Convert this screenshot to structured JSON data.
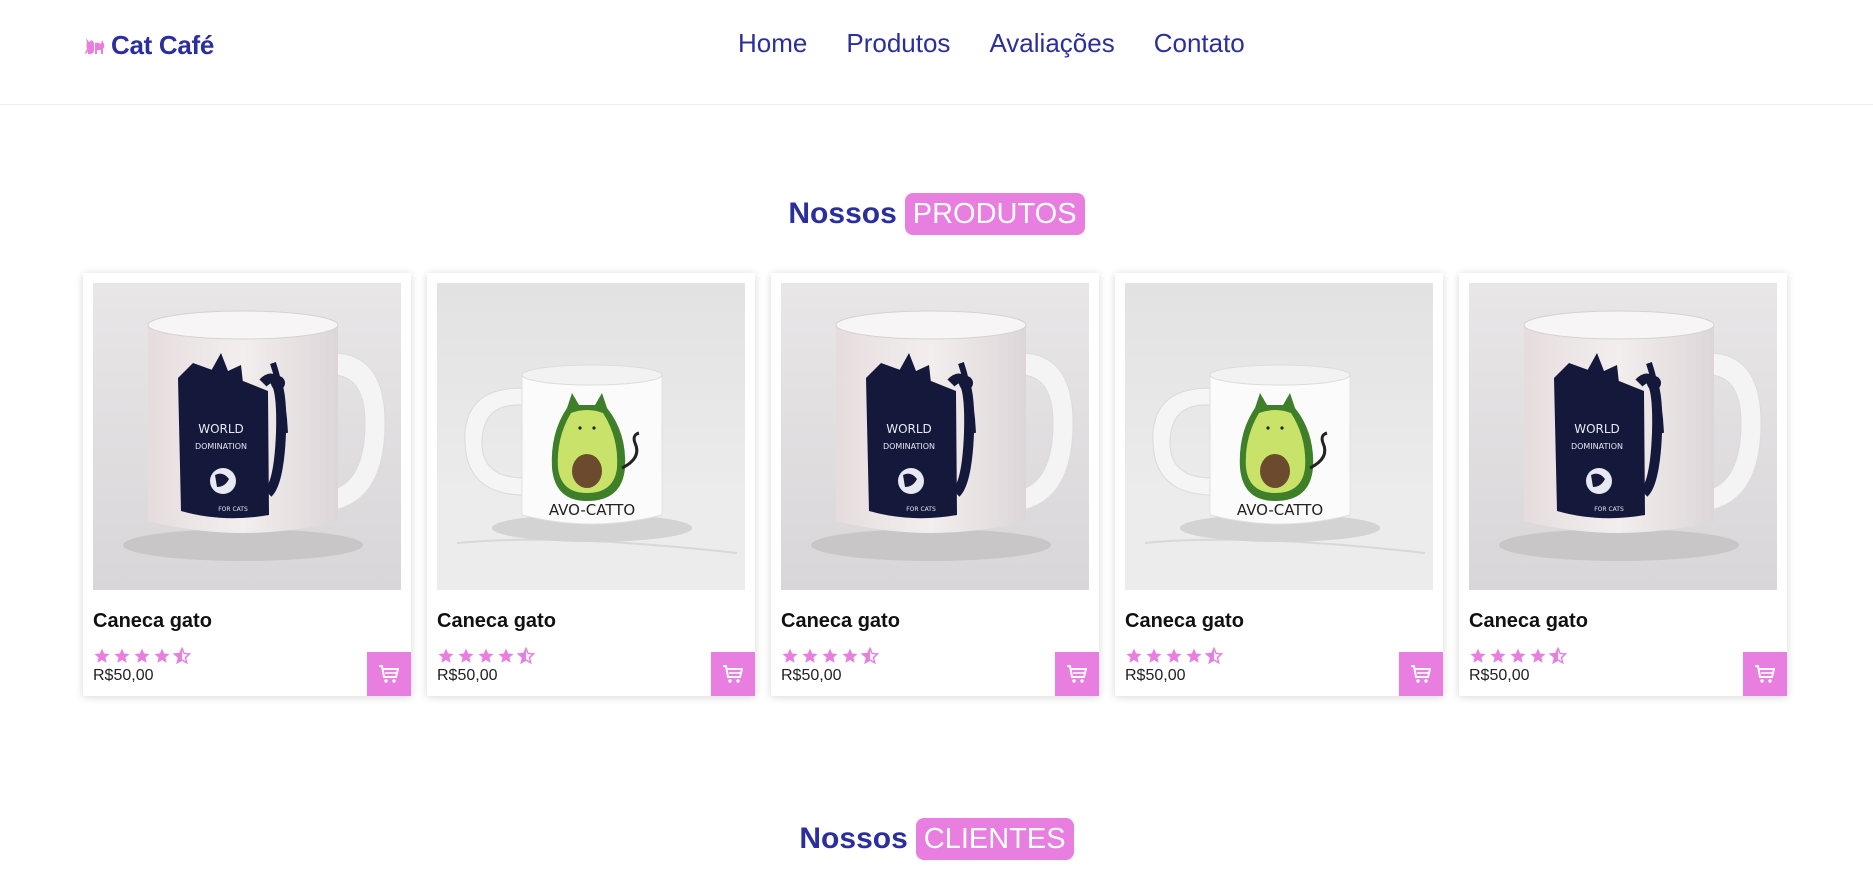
{
  "header": {
    "logo_text": "Cat Café",
    "logo_icon": "cat-icon",
    "nav": [
      "Home",
      "Produtos",
      "Avaliações",
      "Contato"
    ]
  },
  "products_section": {
    "title_word": "Nossos",
    "title_badge": "PRODUTOS"
  },
  "clients_section": {
    "title_word": "Nossos",
    "title_badge": "CLIENTES"
  },
  "products": [
    {
      "name": "Caneca gato",
      "price": "R$50,00",
      "rating": 4.5,
      "image": "world-domination-mug",
      "mug_text": [
        "WORLD",
        "DOMINATION",
        "FOR CATS"
      ]
    },
    {
      "name": "Caneca gato",
      "price": "R$50,00",
      "rating": 4.5,
      "image": "avo-catto-mug",
      "mug_text": [
        "AVO-CATTO"
      ]
    },
    {
      "name": "Caneca gato",
      "price": "R$50,00",
      "rating": 4.5,
      "image": "world-domination-mug",
      "mug_text": [
        "WORLD",
        "DOMINATION",
        "FOR CATS"
      ]
    },
    {
      "name": "Caneca gato",
      "price": "R$50,00",
      "rating": 4.5,
      "image": "avo-catto-mug",
      "mug_text": [
        "AVO-CATTO"
      ]
    },
    {
      "name": "Caneca gato",
      "price": "R$50,00",
      "rating": 4.5,
      "image": "world-domination-mug",
      "mug_text": [
        "WORLD",
        "DOMINATION",
        "FOR CATS"
      ]
    }
  ],
  "colors": {
    "brand_blue": "#2b2f9e",
    "accent_pink": "#e77ee0"
  }
}
